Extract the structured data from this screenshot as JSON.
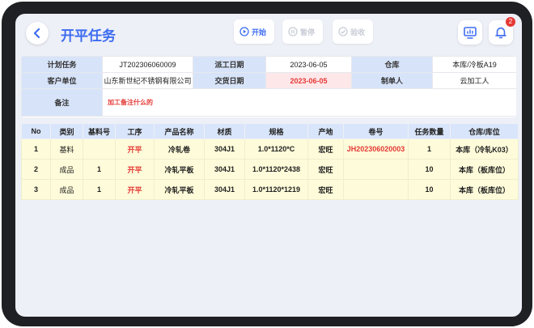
{
  "header": {
    "title": "开平任务",
    "start_label": "开始",
    "pause_label": "暂停",
    "check_label": "验收",
    "notification_count": "2"
  },
  "info": {
    "plan_task_label": "计划任务",
    "plan_task_value": "JT202306060009",
    "dispatch_date_label": "派工日期",
    "dispatch_date_value": "2023-06-05",
    "warehouse_label": "仓库",
    "warehouse_value": "本库/冷板A19",
    "customer_label": "客户单位",
    "customer_value": "山东新世纪不锈钢有限公司",
    "delivery_date_label": "交货日期",
    "delivery_date_value": "2023-06-05",
    "creator_label": "制单人",
    "creator_value": "云加工人",
    "remark_label": "备注",
    "remark_value": "加工备注什么的"
  },
  "table": {
    "columns": [
      "No",
      "类别",
      "基料号",
      "工序",
      "产品名称",
      "材质",
      "规格",
      "产地",
      "卷号",
      "任务数量",
      "仓库/库位"
    ],
    "rows": [
      {
        "no": "1",
        "category": "基料",
        "base_no": "",
        "process": "开平",
        "product": "冷轧卷",
        "material": "304J1",
        "spec": "1.0*1120*C",
        "origin": "宏旺",
        "coil_no": "JH202306020003",
        "qty": "1",
        "location": "本库（冷轧K03）"
      },
      {
        "no": "2",
        "category": "成品",
        "base_no": "1",
        "process": "开平",
        "product": "冷轧平板",
        "material": "304J1",
        "spec": "1.0*1120*2438",
        "origin": "宏旺",
        "coil_no": "",
        "qty": "10",
        "location": "本库（板库位）"
      },
      {
        "no": "3",
        "category": "成品",
        "base_no": "1",
        "process": "开平",
        "product": "冷轧平板",
        "material": "304J1",
        "spec": "1.0*1120*1219",
        "origin": "宏旺",
        "coil_no": "",
        "qty": "10",
        "location": "本库（板库位）"
      }
    ]
  },
  "colors": {
    "accent": "#3d6cf0",
    "header_cell": "#d7e3f8",
    "row_bg": "#fdfbd9",
    "highlight": "#e53935"
  }
}
